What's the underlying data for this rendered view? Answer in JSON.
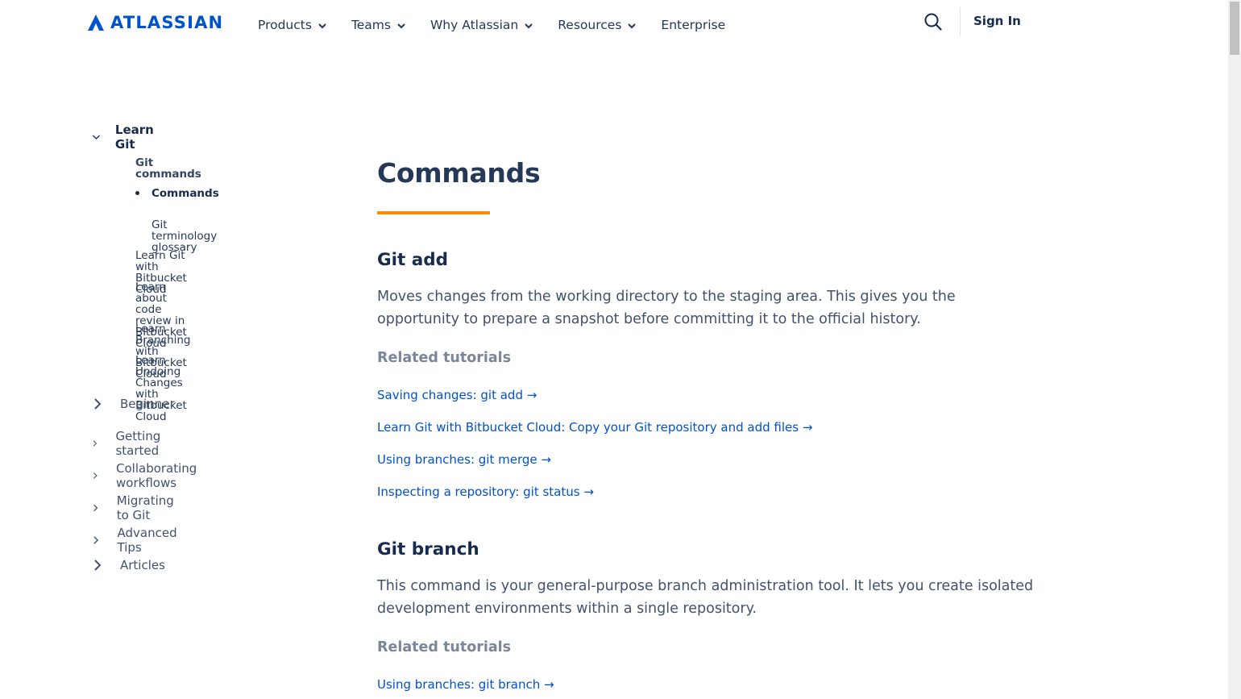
{
  "header": {
    "logo_text": "ATLASSIAN",
    "nav": [
      {
        "label": "Products",
        "has_menu": true
      },
      {
        "label": "Teams",
        "has_menu": true
      },
      {
        "label": "Why Atlassian",
        "has_menu": true
      },
      {
        "label": "Resources",
        "has_menu": true
      },
      {
        "label": "Enterprise",
        "has_menu": false
      }
    ],
    "sign_in": "Sign In"
  },
  "sidebar": {
    "top_label": "Learn Git",
    "sub": {
      "git_commands": "Git commands",
      "commands": "Commands",
      "glossary": "Git terminology glossary",
      "bitbucket_cloud": "Learn Git with Bitbucket Cloud",
      "code_review_1": "Learn about code review in Bitbucket",
      "code_review_2": "Cloud",
      "branching": "Learn Branching with Bitbucket Cloud",
      "undoing_1": "Learn Undoing Changes with Bitbucket",
      "undoing_2": "Cloud"
    },
    "categories": [
      "Beginner",
      "Getting started",
      "Collaborating workflows",
      "Migrating to Git",
      "Advanced Tips",
      "Articles"
    ]
  },
  "main": {
    "title": "Commands",
    "sections": [
      {
        "heading": "Git add",
        "para_1": "Moves changes from the working directory to the staging area. This gives you the",
        "para_2": "opportunity to prepare a snapshot before committing it to the official history.",
        "related_label": "Related tutorials",
        "links": [
          "Saving changes: git add →",
          "Learn Git with Bitbucket Cloud: Copy your Git repository and add files →",
          "Using branches: git merge →",
          "Inspecting a repository: git status →"
        ]
      },
      {
        "heading": "Git branch",
        "para_1": "This command is your general-purpose branch administration tool. It lets you create isolated",
        "para_2": "development environments within a single repository.",
        "related_label": "Related tutorials",
        "links": [
          "Using branches: git branch →"
        ]
      }
    ]
  },
  "colors": {
    "brand": "#0052cc",
    "accent_rule": "#ff8b00",
    "link": "#0052cc",
    "muted_heading": "#7a869a"
  },
  "icons": {
    "search": "search-icon",
    "chevron_down": "chevron-down-icon",
    "chevron_right": "chevron-right-icon"
  }
}
